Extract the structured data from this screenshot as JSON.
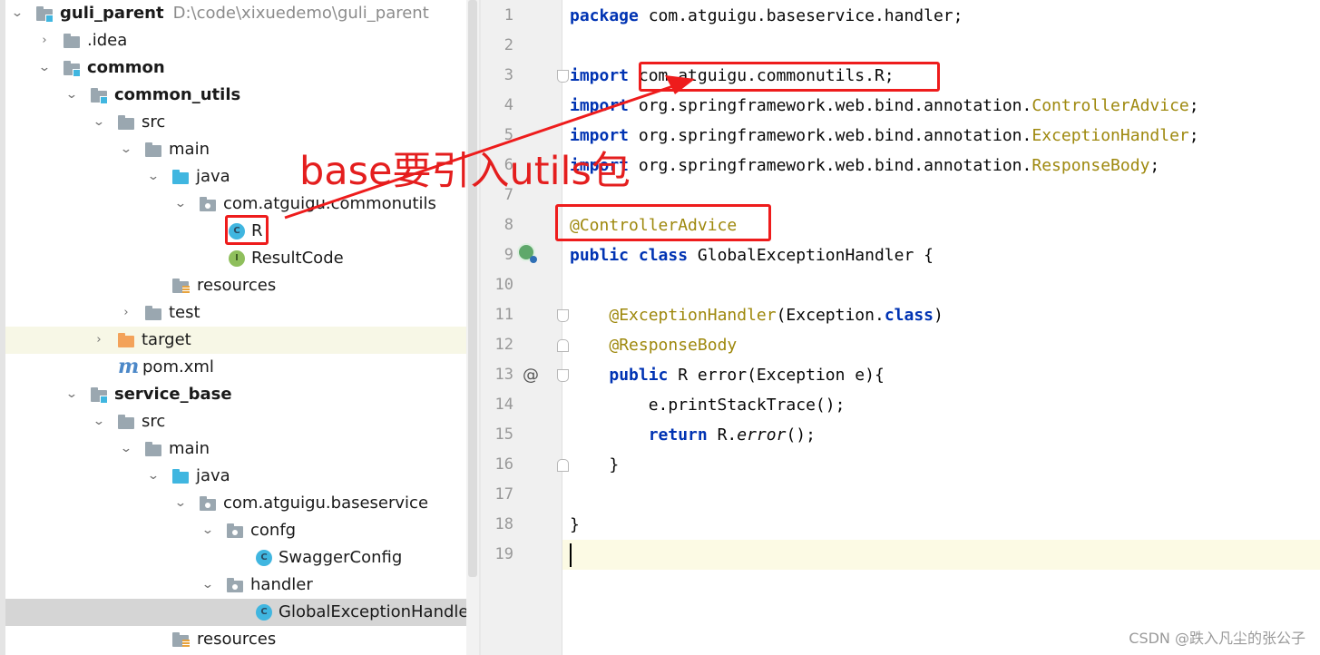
{
  "project_tree": {
    "rows": [
      {
        "id": "guli_parent",
        "label": "guli_parent",
        "path": "D:\\code\\xixuedemo\\guli_parent",
        "expanded": true,
        "icon": "module-folder-icon",
        "bold": true
      },
      {
        "id": "idea",
        "label": ".idea",
        "expanded": false,
        "icon": "folder-icon"
      },
      {
        "id": "common",
        "label": "common",
        "expanded": true,
        "icon": "module-folder-icon",
        "bold": true
      },
      {
        "id": "common_utils",
        "label": "common_utils",
        "expanded": true,
        "icon": "module-folder-icon",
        "bold": true
      },
      {
        "id": "src1",
        "label": "src",
        "expanded": true,
        "icon": "folder-icon"
      },
      {
        "id": "main1",
        "label": "main",
        "expanded": true,
        "icon": "folder-icon"
      },
      {
        "id": "java1",
        "label": "java",
        "expanded": true,
        "icon": "source-folder-icon"
      },
      {
        "id": "pkg_commonutils",
        "label": "com.atguigu.commonutils",
        "expanded": true,
        "icon": "package-icon"
      },
      {
        "id": "R",
        "label": "R",
        "icon": "class-icon"
      },
      {
        "id": "ResultCode",
        "label": "ResultCode",
        "icon": "interface-icon"
      },
      {
        "id": "resources1",
        "label": "resources",
        "icon": "resources-folder-icon"
      },
      {
        "id": "test",
        "label": "test",
        "expanded": false,
        "icon": "folder-icon"
      },
      {
        "id": "target",
        "label": "target",
        "expanded": false,
        "icon": "excluded-folder-icon"
      },
      {
        "id": "pom",
        "label": "pom.xml",
        "icon": "maven-icon"
      },
      {
        "id": "service_base",
        "label": "service_base",
        "expanded": true,
        "icon": "module-folder-icon",
        "bold": true
      },
      {
        "id": "src2",
        "label": "src",
        "expanded": true,
        "icon": "folder-icon"
      },
      {
        "id": "main2",
        "label": "main",
        "expanded": true,
        "icon": "folder-icon"
      },
      {
        "id": "java2",
        "label": "java",
        "expanded": true,
        "icon": "source-folder-icon"
      },
      {
        "id": "pkg_baseservice",
        "label": "com.atguigu.baseservice",
        "expanded": true,
        "icon": "package-icon"
      },
      {
        "id": "confg",
        "label": "confg",
        "expanded": true,
        "icon": "package-icon"
      },
      {
        "id": "SwaggerConfig",
        "label": "SwaggerConfig",
        "icon": "class-icon"
      },
      {
        "id": "handler",
        "label": "handler",
        "expanded": true,
        "icon": "package-icon"
      },
      {
        "id": "GlobalExceptionHandle",
        "label": "GlobalExceptionHandle",
        "icon": "class-icon"
      },
      {
        "id": "resources2",
        "label": "resources",
        "icon": "resources-folder-icon"
      }
    ],
    "class_icon_letter": "C",
    "interface_icon_letter": "I",
    "maven_icon_letter": "m"
  },
  "editor": {
    "line_numbers": [
      "1",
      "2",
      "3",
      "4",
      "5",
      "6",
      "7",
      "8",
      "9",
      "10",
      "11",
      "12",
      "13",
      "14",
      "15",
      "16",
      "17",
      "18",
      "19"
    ],
    "code": {
      "l1_kw": "package",
      "l1_rest": " com.atguigu.baseservice.handler;",
      "l3_kw": "import",
      "l3_rest": " com.atguigu.commonutils.R;",
      "l4_kw": "import",
      "l4_pre": " org.springframework.web.bind.annotation.",
      "l4_ann": "ControllerAdvice",
      "l4_end": ";",
      "l5_kw": "import",
      "l5_pre": " org.springframework.web.bind.annotation.",
      "l5_ann": "ExceptionHandler",
      "l5_end": ";",
      "l6_kw": "import",
      "l6_pre": " org.springframework.web.bind.annotation.",
      "l6_ann": "ResponseBody",
      "l6_end": ";",
      "l8_ann": "@ControllerAdvice",
      "l9_kw1": "public",
      "l9_kw2": "class",
      "l9_rest": " GlobalExceptionHandler {",
      "l11_ann": "@ExceptionHandler",
      "l11_mid": "(Exception.",
      "l11_kw": "class",
      "l11_end": ")",
      "l12_ann": "@ResponseBody",
      "l13_kw": "public",
      "l13_rest": " R error(Exception e){",
      "l14_text": "e.printStackTrace();",
      "l15_kw": "return",
      "l15_pre": " R.",
      "l15_meth": "error",
      "l15_end": "();",
      "l16_text": "}",
      "l18_text": "}"
    },
    "gutter_at_symbol": "@"
  },
  "annotation": {
    "text": "base要引入utils包",
    "color": "#e41e1e"
  },
  "watermark": "CSDN @跌入凡尘的张公子",
  "colors": {
    "keyword": "#0033b3",
    "annotation": "#9e880d",
    "folder": "#9aa7b0",
    "source_folder": "#40b6e0",
    "excluded_folder": "#f3a25a",
    "red_highlight": "#ee1c1c"
  }
}
